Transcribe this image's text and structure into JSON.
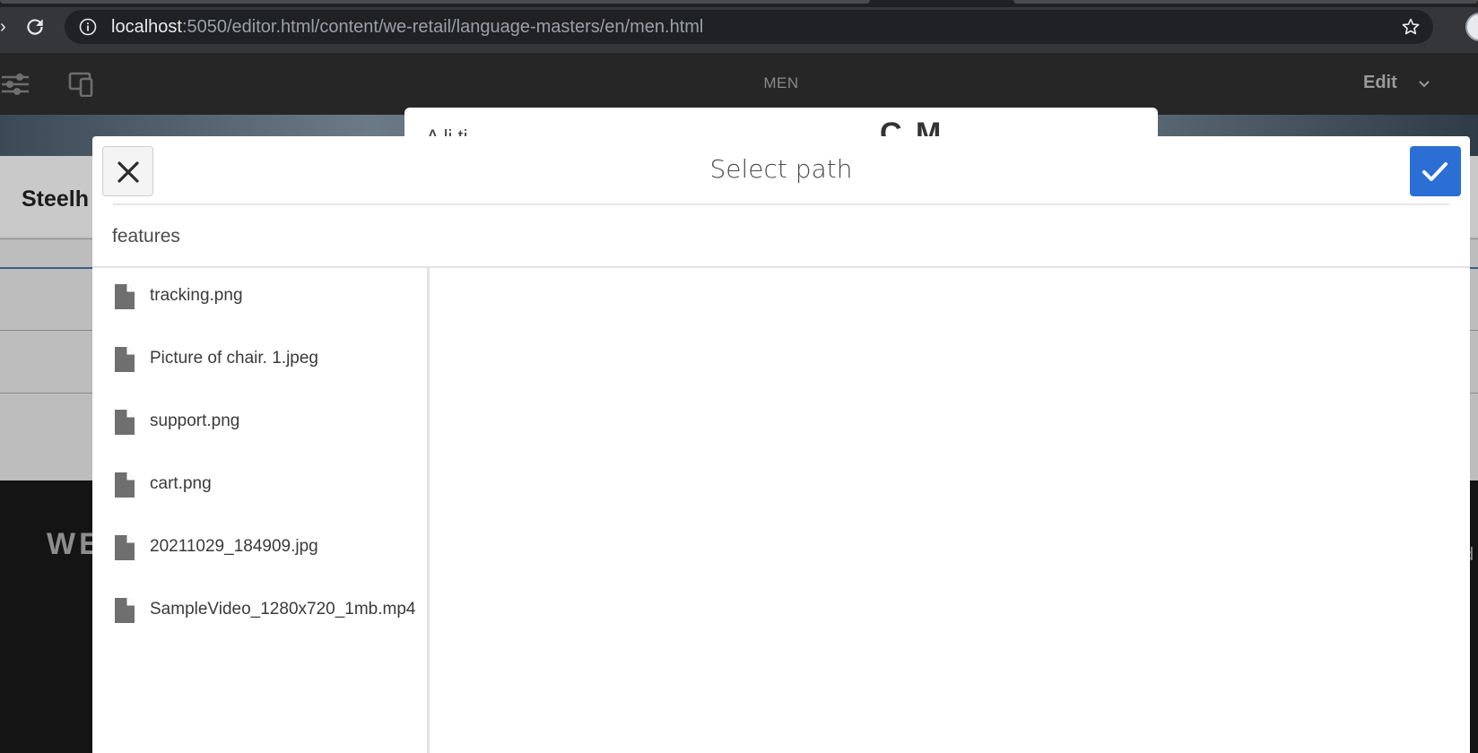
{
  "browser": {
    "url_host": "localhost",
    "url_rest": ":5050/editor.html/content/we-retail/language-masters/en/men.html"
  },
  "editor": {
    "page_name": "MEN",
    "mode_label": "Edit"
  },
  "background": {
    "section_title": "Steelh",
    "footer_logo": "WE",
    "right_peek": "d",
    "under_dialog_text_1": "A  li  ti",
    "under_dialog_text_2": "C   M"
  },
  "dialog": {
    "title": "Select path",
    "breadcrumb": "features",
    "items": [
      {
        "name": "tracking.png",
        "icon": "file-icon"
      },
      {
        "name": "Picture of chair. 1.jpeg",
        "icon": "file-icon"
      },
      {
        "name": "support.png",
        "icon": "file-icon"
      },
      {
        "name": "cart.png",
        "icon": "file-icon"
      },
      {
        "name": "20211029_184909.jpg",
        "icon": "file-icon"
      },
      {
        "name": "SampleVideo_1280x720_1mb.mp4",
        "icon": "file-icon"
      }
    ]
  },
  "colors": {
    "accent": "#2b6ed4",
    "toolbar": "#262626"
  }
}
